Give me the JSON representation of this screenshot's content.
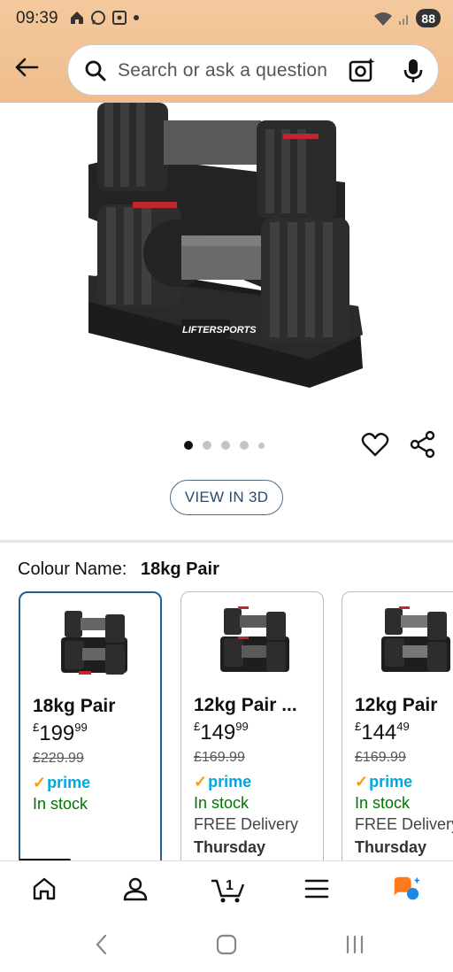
{
  "status_bar": {
    "time": "09:39",
    "battery": "88",
    "icons_left": [
      "home-icon",
      "whatsapp-icon",
      "screenshot-icon",
      "dot-icon"
    ],
    "icons_right": [
      "wifi-icon",
      "signal-icon",
      "battery-icon"
    ]
  },
  "header": {
    "search_placeholder": "Search or ask a question"
  },
  "gallery": {
    "dot_count": 5,
    "active_index": 0,
    "view_3d_label": "VIEW IN 3D",
    "brand_on_product": "LIFTERSPORTS"
  },
  "variant": {
    "label": "Colour Name:",
    "value": "18kg Pair",
    "options": [
      {
        "name": "18kg Pair",
        "price_symbol": "£",
        "price_whole": "199",
        "price_fraction": "99",
        "list_price": "£229.99",
        "prime": "prime",
        "stock": "In stock",
        "delivery": "",
        "delivery_day": "",
        "selected": true
      },
      {
        "name": "12kg Pair ...",
        "price_symbol": "£",
        "price_whole": "149",
        "price_fraction": "99",
        "list_price": "£169.99",
        "prime": "prime",
        "stock": "In stock",
        "delivery": "FREE Delivery",
        "delivery_day": "Thursday",
        "selected": false
      },
      {
        "name": "12kg Pair",
        "price_symbol": "£",
        "price_whole": "144",
        "price_fraction": "49",
        "list_price": "£169.99",
        "prime": "prime",
        "stock": "In stock",
        "delivery": "FREE Delivery",
        "delivery_day": "Thursday",
        "selected": false
      }
    ]
  },
  "bottom_nav": {
    "items": [
      "home-icon",
      "account-icon",
      "cart-icon",
      "menu-icon",
      "rufus-icon"
    ],
    "cart_count": "1"
  },
  "colors": {
    "header_bg": "#efbd8c",
    "selected_border": "#1f5d99",
    "prime_blue": "#00a8e1",
    "prime_check": "#ff9900",
    "in_stock": "#007600"
  }
}
